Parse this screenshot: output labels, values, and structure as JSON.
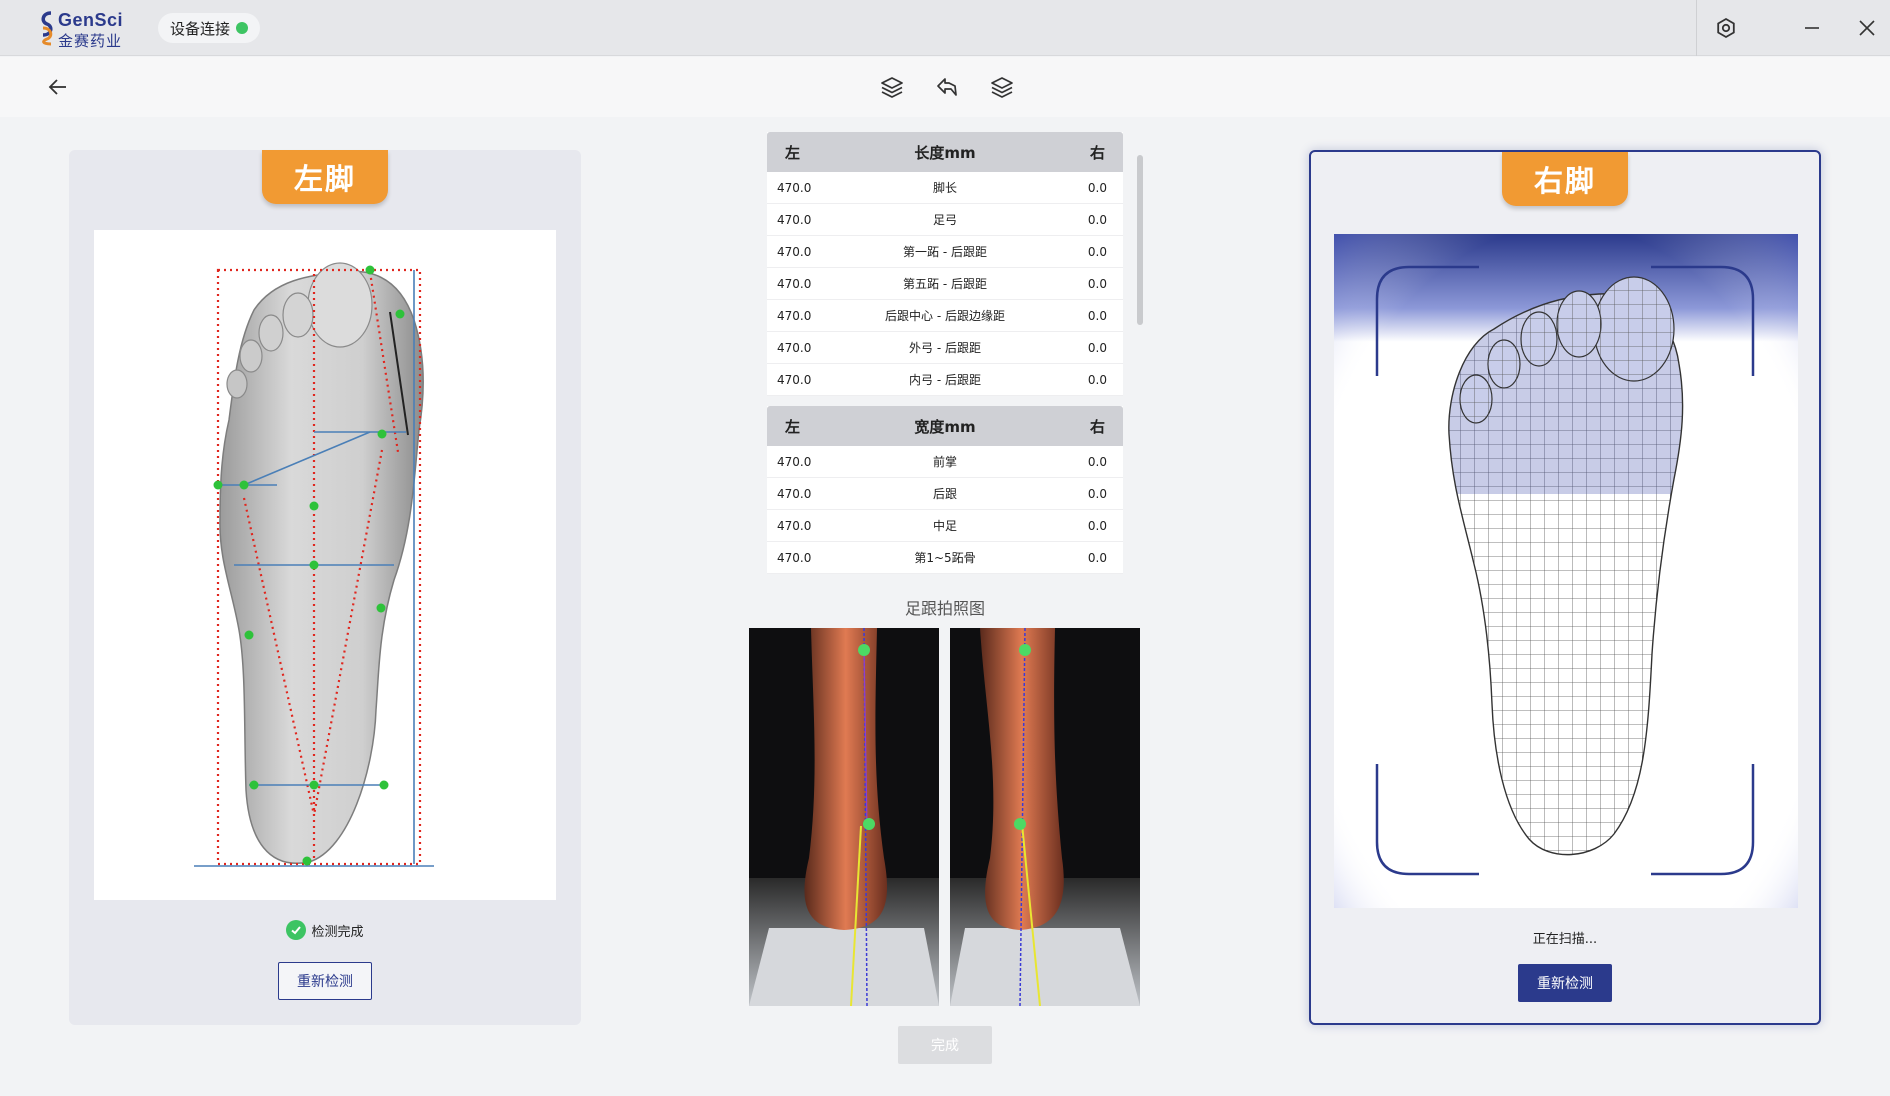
{
  "app": {
    "logo_en": "GenSci",
    "logo_cn": "金赛药业",
    "device_status": "设备连接"
  },
  "left_panel": {
    "tab_label": "左脚",
    "status": "检测完成",
    "retest_label": "重新检测"
  },
  "right_panel": {
    "tab_label": "右脚",
    "status": "正在扫描...",
    "retest_label": "重新检测"
  },
  "length_table": {
    "header": {
      "left": "左",
      "title": "长度mm",
      "right": "右"
    },
    "rows": [
      {
        "left": "470.0",
        "name": "脚长",
        "right": "0.0"
      },
      {
        "left": "470.0",
        "name": "足弓",
        "right": "0.0"
      },
      {
        "left": "470.0",
        "name": "第一跖 - 后跟距",
        "right": "0.0"
      },
      {
        "left": "470.0",
        "name": "第五跖 - 后跟距",
        "right": "0.0"
      },
      {
        "left": "470.0",
        "name": "后跟中心 - 后跟边缘距",
        "right": "0.0"
      },
      {
        "left": "470.0",
        "name": "外弓 - 后跟距",
        "right": "0.0"
      },
      {
        "left": "470.0",
        "name": "内弓 - 后跟距",
        "right": "0.0"
      }
    ]
  },
  "width_table": {
    "header": {
      "left": "左",
      "title": "宽度mm",
      "right": "右"
    },
    "rows": [
      {
        "left": "470.0",
        "name": "前掌",
        "right": "0.0"
      },
      {
        "left": "470.0",
        "name": "后跟",
        "right": "0.0"
      },
      {
        "left": "470.0",
        "name": "中足",
        "right": "0.0"
      },
      {
        "left": "470.0",
        "name": "第1~5跖骨",
        "right": "0.0"
      }
    ]
  },
  "photos": {
    "title": "足跟拍照图"
  },
  "done_label": "完成",
  "colors": {
    "brand": "#2b3a8c",
    "accent_orange": "#f19a33",
    "status_green": "#3dc463",
    "disabled": "#dcdde0"
  },
  "icons": {
    "settings": "gear-icon",
    "minimize": "minimize-icon",
    "close": "close-icon",
    "back": "arrow-left-icon",
    "toolbar": [
      "layers-icon",
      "undo-icon",
      "layers-icon"
    ]
  }
}
